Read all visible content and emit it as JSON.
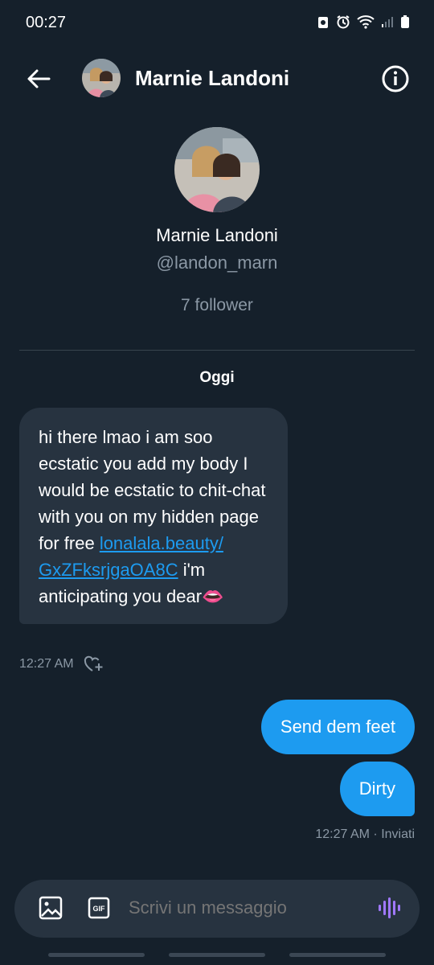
{
  "status_bar": {
    "time": "00:27"
  },
  "header": {
    "name": "Marnie Landoni"
  },
  "profile": {
    "name": "Marnie Landoni",
    "handle": "@landon_marn",
    "followers": "7 follower"
  },
  "conversation": {
    "day_label": "Oggi",
    "incoming": {
      "text_before_link": "hi  there lmao i am soo ecstatic you add my body I would be ecstatic to chit-chat with you on my hidden page for free ",
      "link_text": "lonalala.beauty/ GxZFksrjgaOA8C",
      "text_after_link": " i'm  anticipating you dear",
      "emoji": "👄",
      "time": "12:27 AM"
    },
    "outgoing": [
      {
        "text": "Send dem feet"
      },
      {
        "text": "Dirty"
      }
    ],
    "outgoing_meta": "12:27 AM · Inviati"
  },
  "composer": {
    "placeholder": "Scrivi un messaggio"
  },
  "colors": {
    "background": "#15202b",
    "accent": "#1d9bf0",
    "incoming_bubble": "#273340",
    "muted_text": "#8b98a5",
    "voice_icon": "#a078ff"
  }
}
